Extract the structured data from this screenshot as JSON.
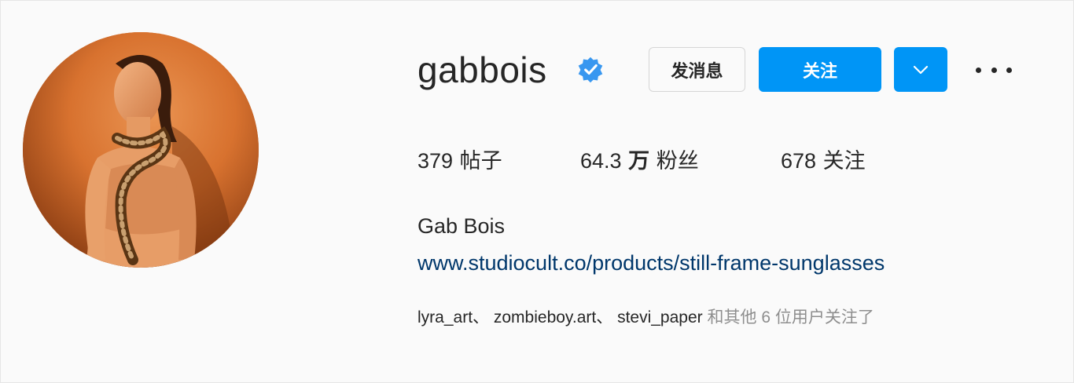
{
  "profile": {
    "username": "gabbois",
    "verified": true,
    "full_name": "Gab Bois",
    "link": "www.studiocult.co/products/still-frame-sunglasses",
    "avatar_icon": "profile-photo-woman-with-snake"
  },
  "actions": {
    "message_label": "发消息",
    "follow_label": "关注",
    "dropdown_icon": "chevron-down-icon",
    "more_icon": "more-horizontal-icon"
  },
  "stats": {
    "posts_count": "379",
    "posts_label": "帖子",
    "followers_count": "64.3",
    "followers_unit": "万",
    "followers_label": "粉丝",
    "following_count": "678",
    "following_label": "关注"
  },
  "followed_by": {
    "users": [
      "lyra_art",
      "zombieboy.art",
      "stevi_paper"
    ],
    "separator": "、",
    "suffix": "和其他 6 位用户关注了"
  },
  "colors": {
    "accent": "#0095f6",
    "link": "#00376b",
    "verified": "#3897f0",
    "text": "#262626",
    "muted": "#8e8e8e",
    "background": "#fafafa"
  }
}
